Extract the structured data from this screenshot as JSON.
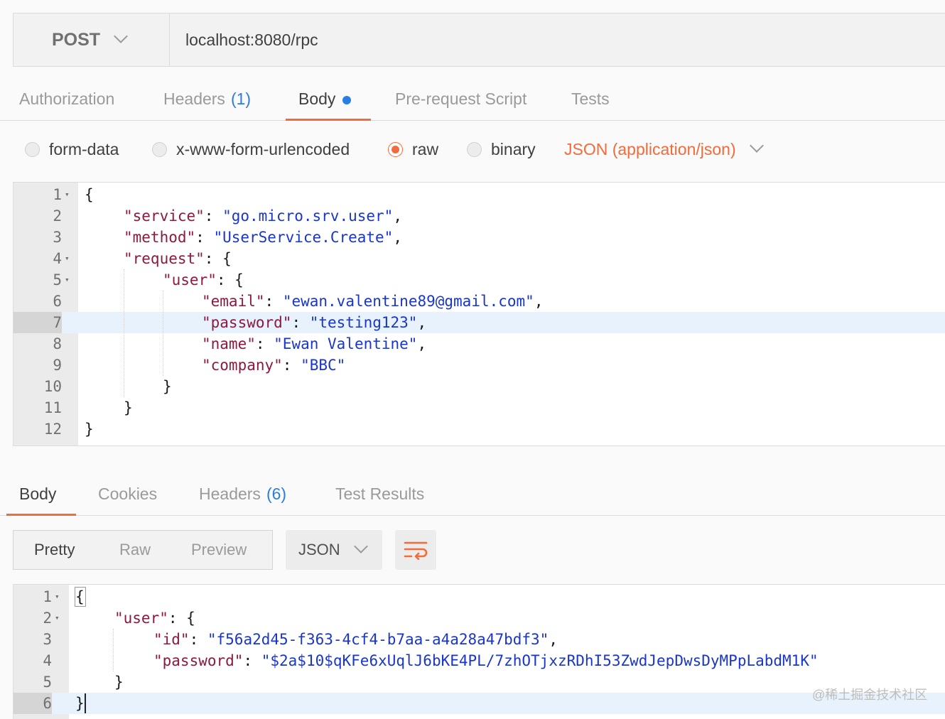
{
  "request": {
    "method": "POST",
    "url": "localhost:8080/rpc"
  },
  "request_tabs": [
    {
      "label": "Authorization",
      "count": ""
    },
    {
      "label": "Headers",
      "count": "(1)"
    },
    {
      "label": "Body",
      "count": ""
    },
    {
      "label": "Pre-request Script",
      "count": ""
    },
    {
      "label": "Tests",
      "count": ""
    }
  ],
  "body_types": {
    "options": [
      "form-data",
      "x-www-form-urlencoded",
      "raw",
      "binary"
    ],
    "selected": "raw",
    "content_type": "JSON (application/json)"
  },
  "request_body": {
    "line_numbers": [
      "1",
      "2",
      "3",
      "4",
      "5",
      "6",
      "7",
      "8",
      "9",
      "10",
      "11",
      "12"
    ],
    "highlighted_line": "7",
    "lines": [
      [
        "{"
      ],
      [
        "\"service\"",
        ": ",
        "\"go.micro.srv.user\"",
        ","
      ],
      [
        "\"method\"",
        ": ",
        "\"UserService.Create\"",
        ","
      ],
      [
        "\"request\"",
        ": {"
      ],
      [
        "\"user\"",
        ": {"
      ],
      [
        "\"email\"",
        ": ",
        "\"ewan.valentine89@gmail.com\"",
        ","
      ],
      [
        "\"password\"",
        ": ",
        "\"testing123\"",
        ","
      ],
      [
        "\"name\"",
        ": ",
        "\"Ewan Valentine\"",
        ","
      ],
      [
        "\"company\"",
        ": ",
        "\"BBC\""
      ],
      [
        "}"
      ],
      [
        "}"
      ],
      [
        "}"
      ]
    ]
  },
  "response_tabs": [
    {
      "label": "Body",
      "count": ""
    },
    {
      "label": "Cookies",
      "count": ""
    },
    {
      "label": "Headers",
      "count": "(6)"
    },
    {
      "label": "Test Results",
      "count": ""
    }
  ],
  "response_view": {
    "modes": [
      "Pretty",
      "Raw",
      "Preview"
    ],
    "selected_mode": "Pretty",
    "format": "JSON",
    "wrap_icon": "wrap-lines-icon",
    "accent_color": "#f26b3a"
  },
  "response_body": {
    "line_numbers": [
      "1",
      "2",
      "3",
      "4",
      "5",
      "6"
    ],
    "highlighted_line": "6",
    "lines": [
      [
        "{"
      ],
      [
        "\"user\"",
        ": {"
      ],
      [
        "\"id\"",
        ": ",
        "\"f56a2d45-f363-4cf4-b7aa-a4a28a47bdf3\"",
        ","
      ],
      [
        "\"password\"",
        ": ",
        "\"$2a$10$qKFe6xUqlJ6bKE4PL/7zhOTjxzRDhI53ZwdJepDwsDyMPpLabdM1K\""
      ],
      [
        "}"
      ],
      [
        "}"
      ]
    ]
  },
  "watermark": "@稀土掘金技术社区"
}
